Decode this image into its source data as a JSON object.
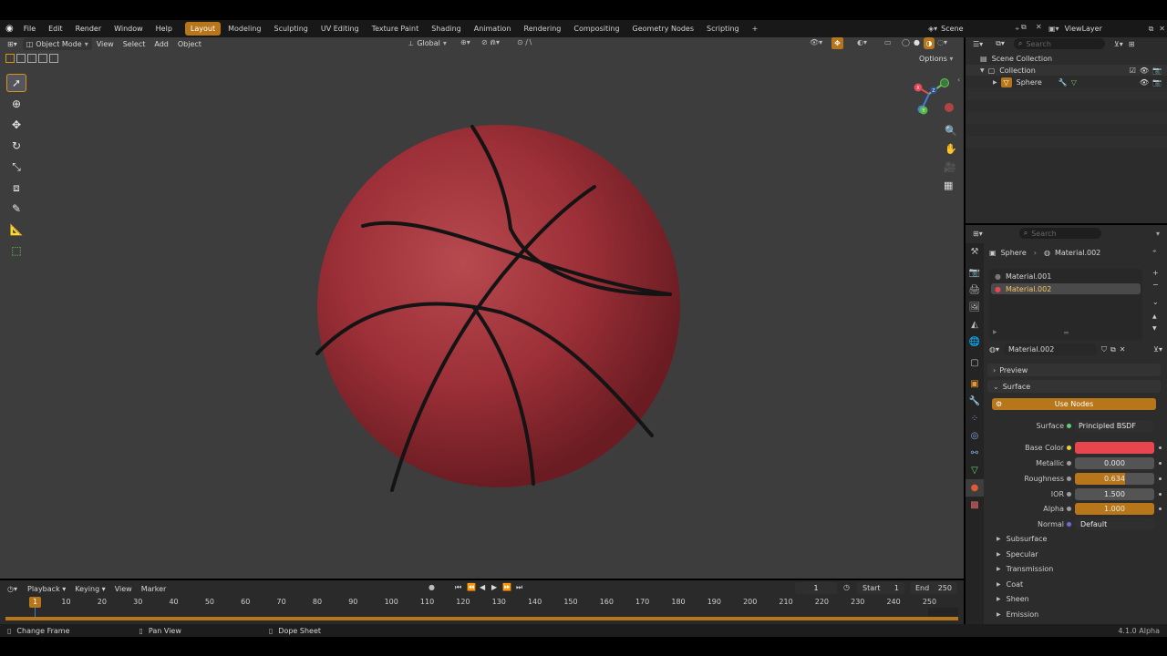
{
  "topbar": {
    "menus": [
      "File",
      "Edit",
      "Render",
      "Window",
      "Help"
    ],
    "workspaces": [
      "Layout",
      "Modeling",
      "Sculpting",
      "UV Editing",
      "Texture Paint",
      "Shading",
      "Animation",
      "Rendering",
      "Compositing",
      "Geometry Nodes",
      "Scripting"
    ],
    "active_workspace": "Layout",
    "add_tab": "+",
    "scene": "Scene",
    "view_layer": "ViewLayer"
  },
  "viewport": {
    "mode": "Object Mode",
    "menus": [
      "View",
      "Select",
      "Add",
      "Object"
    ],
    "transform_orientation": "Global",
    "options": "Options",
    "gizmo_axes": {
      "x": "X",
      "y": "Y",
      "z": "Z"
    }
  },
  "outliner": {
    "search_placeholder": "Search",
    "scene_collection": "Scene Collection",
    "collection": "Collection",
    "object": "Sphere"
  },
  "properties": {
    "search_placeholder": "Search",
    "breadcrumb_object": "Sphere",
    "breadcrumb_material": "Material.002",
    "slots": [
      "Material.001",
      "Material.002"
    ],
    "active_slot": "Material.002",
    "material_name": "Material.002",
    "preview": "Preview",
    "surface_section": "Surface",
    "use_nodes": "Use Nodes",
    "surface_label": "Surface",
    "surface_value": "Principled BSDF",
    "base_color_label": "Base Color",
    "base_color": "#e8464e",
    "metallic_label": "Metallic",
    "metallic": "0.000",
    "roughness_label": "Roughness",
    "roughness": "0.634",
    "roughness_fraction": 0.634,
    "ior_label": "IOR",
    "ior": "1.500",
    "alpha_label": "Alpha",
    "alpha": "1.000",
    "alpha_fraction": 1.0,
    "normal_label": "Normal",
    "normal": "Default",
    "subsections": [
      "Subsurface",
      "Specular",
      "Transmission",
      "Coat",
      "Sheen",
      "Emission"
    ]
  },
  "timeline": {
    "menus": [
      "Playback",
      "Keying",
      "View",
      "Marker"
    ],
    "current_frame": "1",
    "start_label": "Start",
    "start": "1",
    "end_label": "End",
    "end": "250",
    "ruler": [
      "10",
      "20",
      "30",
      "40",
      "50",
      "60",
      "70",
      "80",
      "90",
      "100",
      "110",
      "120",
      "130",
      "140",
      "150",
      "160",
      "170",
      "180",
      "190",
      "200",
      "210",
      "220",
      "230",
      "240",
      "250"
    ],
    "playhead": "1"
  },
  "statusbar": {
    "change_frame": "Change Frame",
    "pan_view": "Pan View",
    "dope_sheet": "Dope Sheet",
    "version": "4.1.0 Alpha"
  },
  "colors": {
    "accent": "#b8761a",
    "ball": "#a4323a"
  }
}
